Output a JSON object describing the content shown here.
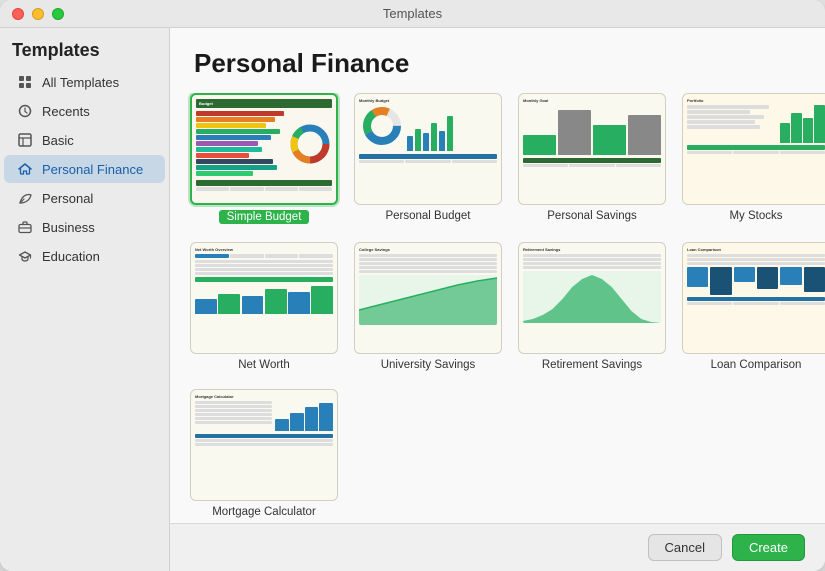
{
  "window": {
    "title": "Templates"
  },
  "sidebar": {
    "title": "Templates",
    "items": [
      {
        "id": "all-templates",
        "label": "All Templates",
        "icon": "grid"
      },
      {
        "id": "recents",
        "label": "Recents",
        "icon": "clock"
      },
      {
        "id": "basic",
        "label": "Basic",
        "icon": "table"
      },
      {
        "id": "personal-finance",
        "label": "Personal Finance",
        "icon": "house",
        "active": true
      },
      {
        "id": "personal",
        "label": "Personal",
        "icon": "leaf"
      },
      {
        "id": "business",
        "label": "Business",
        "icon": "briefcase"
      },
      {
        "id": "education",
        "label": "Education",
        "icon": "graduation"
      }
    ]
  },
  "main": {
    "title": "Personal Finance",
    "templates": [
      {
        "id": "simple-budget",
        "label": "Simple Budget",
        "selected": true
      },
      {
        "id": "personal-budget",
        "label": "Personal Budget",
        "selected": false
      },
      {
        "id": "personal-savings",
        "label": "Personal Savings",
        "selected": false
      },
      {
        "id": "my-stocks",
        "label": "My Stocks",
        "selected": false
      },
      {
        "id": "net-worth",
        "label": "Net Worth",
        "selected": false
      },
      {
        "id": "university-savings",
        "label": "University Savings",
        "selected": false
      },
      {
        "id": "retirement-savings",
        "label": "Retirement Savings",
        "selected": false
      },
      {
        "id": "loan-comparison",
        "label": "Loan Comparison",
        "selected": false
      },
      {
        "id": "mortgage-calculator",
        "label": "Mortgage Calculator",
        "selected": false
      }
    ]
  },
  "footer": {
    "cancel_label": "Cancel",
    "create_label": "Create"
  }
}
